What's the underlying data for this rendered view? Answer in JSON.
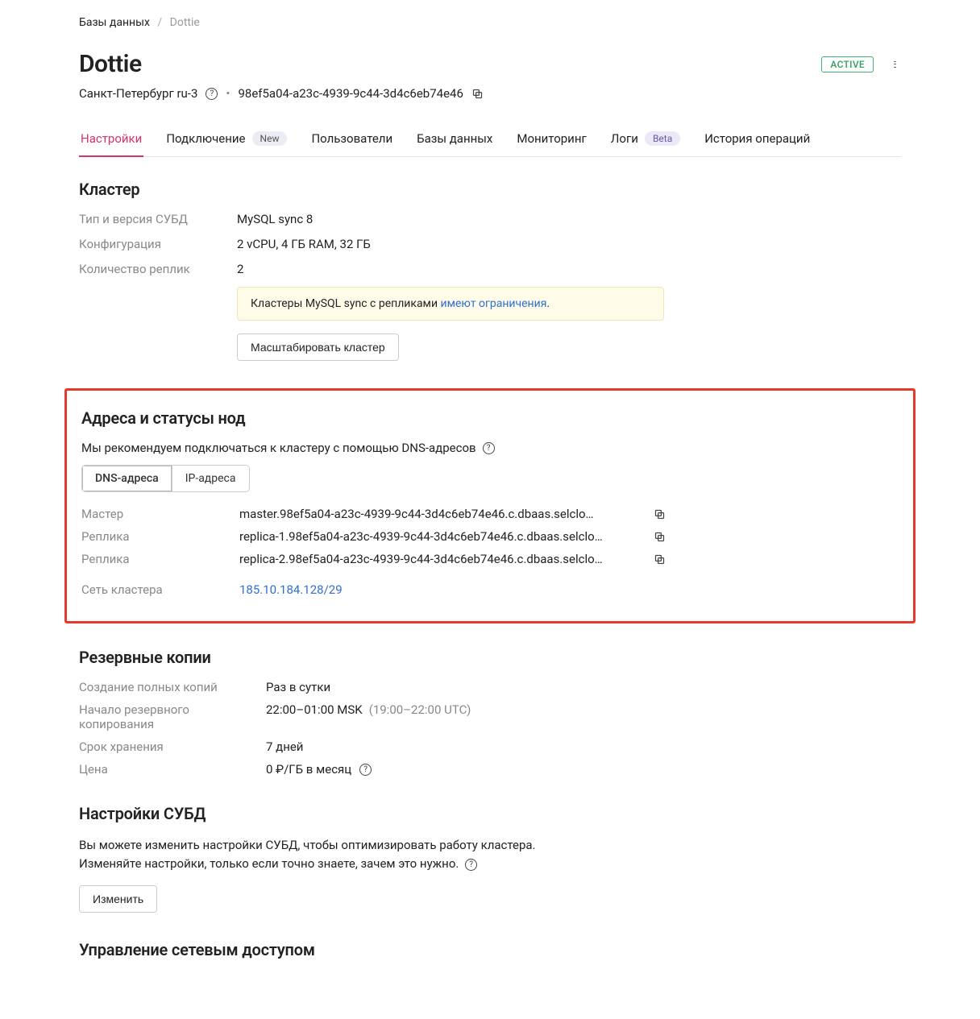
{
  "breadcrumb": {
    "root": "Базы данных",
    "current": "Dottie"
  },
  "header": {
    "title": "Dottie",
    "status": "ACTIVE",
    "region": "Санкт-Петербург ru-3",
    "uuid": "98ef5a04-a23c-4939-9c44-3d4c6eb74e46"
  },
  "tabs": {
    "settings": "Настройки",
    "connection": "Подключение",
    "connection_badge": "New",
    "users": "Пользователи",
    "databases": "Базы данных",
    "monitoring": "Мониторинг",
    "logs": "Логи",
    "logs_badge": "Beta",
    "history": "История операций"
  },
  "cluster": {
    "title": "Кластер",
    "type_label": "Тип и версия СУБД",
    "type_value": "MySQL sync 8",
    "config_label": "Конфигурация",
    "config_value": "2 vCPU, 4 ГБ RAM, 32 ГБ",
    "replicas_label": "Количество реплик",
    "replicas_value": "2",
    "info_prefix": "Кластеры MySQL sync с репликами ",
    "info_link": "имеют ограничения",
    "info_suffix": ".",
    "scale_btn": "Масштабировать кластер"
  },
  "nodes": {
    "title": "Адреса и статусы нод",
    "recommend": "Мы рекомендуем подключаться к кластеру с помощью DNS-адресов",
    "seg_dns": "DNS-адреса",
    "seg_ip": "IP-адреса",
    "rows": [
      {
        "role": "Мастер",
        "addr": "master.98ef5a04-a23c-4939-9c44-3d4c6eb74e46.c.dbaas.selclo…"
      },
      {
        "role": "Реплика",
        "addr": "replica-1.98ef5a04-a23c-4939-9c44-3d4c6eb74e46.c.dbaas.selclo…"
      },
      {
        "role": "Реплика",
        "addr": "replica-2.98ef5a04-a23c-4939-9c44-3d4c6eb74e46.c.dbaas.selclo…"
      }
    ],
    "net_label": "Сеть кластера",
    "net_value": "185.10.184.128/29"
  },
  "backups": {
    "title": "Резервные копии",
    "full_label": "Создание полных копий",
    "full_value": "Раз в сутки",
    "start_label": "Начало резервного копирования",
    "start_local": "22:00–01:00 MSK",
    "start_utc": "(19:00–22:00 UTC)",
    "retention_label": "Срок хранения",
    "retention_value": "7 дней",
    "price_label": "Цена",
    "price_value": "0 ₽/ГБ в месяц"
  },
  "dbms": {
    "title": "Настройки СУБД",
    "desc1": "Вы можете изменить настройки СУБД, чтобы оптимизировать работу кластера.",
    "desc2": "Изменяйте настройки, только если точно знаете, зачем это нужно.",
    "edit_btn": "Изменить"
  },
  "network": {
    "title": "Управление сетевым доступом"
  }
}
